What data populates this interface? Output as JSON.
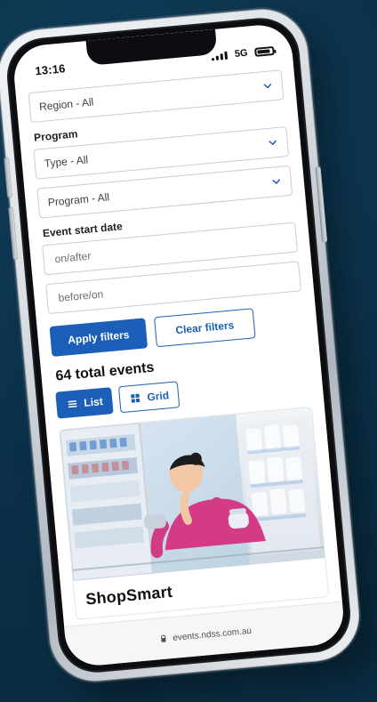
{
  "status_bar": {
    "time": "13:16",
    "network": "5G"
  },
  "filters": {
    "region_select": {
      "value": "Region - All"
    },
    "program": {
      "label": "Program",
      "type_select": {
        "value": "Type - All"
      },
      "program_select": {
        "value": "Program - All"
      }
    },
    "event_start_date": {
      "label": "Event start date",
      "after_placeholder": "on/after",
      "before_placeholder": "before/on"
    },
    "apply_label": "Apply filters",
    "clear_label": "Clear filters"
  },
  "results": {
    "total_events": "64 total events",
    "view_toggle": {
      "list_label": "List",
      "grid_label": "Grid"
    }
  },
  "featured_card": {
    "title": "ShopSmart"
  },
  "browser": {
    "url": "events.ndss.com.au"
  },
  "icons": {
    "chevron": "chevron-down-icon",
    "list": "list-icon",
    "grid": "grid-icon",
    "lock": "lock-icon"
  },
  "colors": {
    "accent": "#1b5fb8",
    "background": "#0d3550",
    "border": "#c7ccd3"
  }
}
